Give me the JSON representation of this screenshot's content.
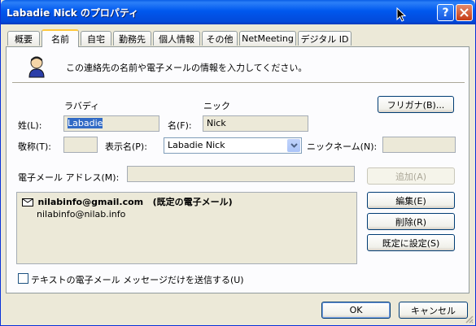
{
  "window": {
    "title": "Labadie Nick のプロパティ"
  },
  "tabs": [
    {
      "label": "概要"
    },
    {
      "label": "名前"
    },
    {
      "label": "自宅"
    },
    {
      "label": "勤務先"
    },
    {
      "label": "個人情報"
    },
    {
      "label": "その他"
    },
    {
      "label": "NetMeeting"
    },
    {
      "label": "デジタル ID"
    }
  ],
  "name_page": {
    "description": "この連絡先の名前や電子メールの情報を入力してください。",
    "yomi_last": "ラバディ",
    "yomi_first": "ニック",
    "furigana_button": "フリガナ(B)...",
    "last_label": "姓(L):",
    "last_value": "Labadie",
    "first_label": "名(F):",
    "first_value": "Nick",
    "title_label": "敬称(T):",
    "title_value": "",
    "display_label": "表示名(P):",
    "display_value": "Labadie Nick",
    "nickname_label": "ニックネーム(N):",
    "nickname_value": "",
    "email_label": "電子メール アドレス(M):",
    "email_value": "",
    "add_button": "追加(A)",
    "emails": [
      {
        "address": "nilabinfo@gmail.com",
        "note": "(既定の電子メール)"
      },
      {
        "address": "nilabinfo@nilab.info",
        "note": ""
      }
    ],
    "edit_button": "編集(E)",
    "delete_button": "削除(R)",
    "default_button": "既定に設定(S)",
    "plaintext_label": "テキストの電子メール メッセージだけを送信する(U)"
  },
  "footer": {
    "ok": "OK",
    "cancel": "キャンセル"
  },
  "colors": {
    "titlebar": "#0058ee",
    "face": "#ece9d8",
    "tab_highlight": "#ffc83c"
  }
}
